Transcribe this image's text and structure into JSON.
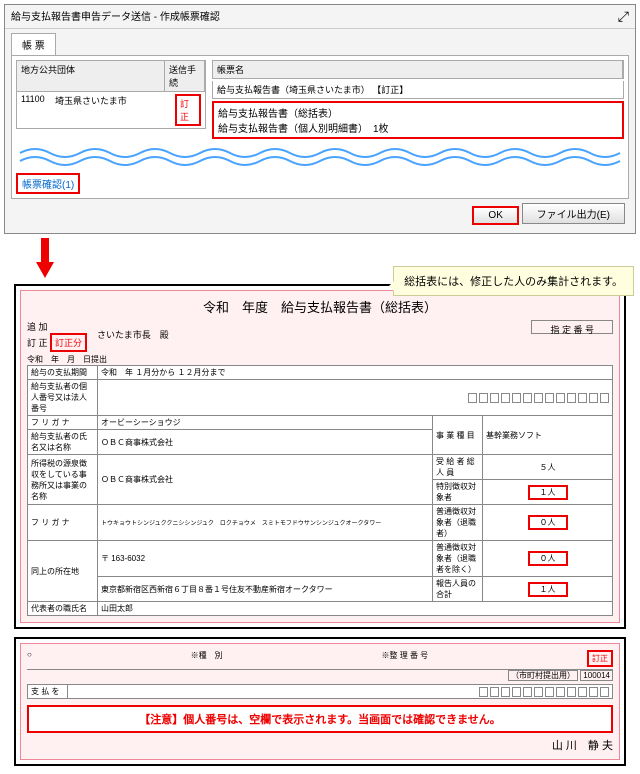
{
  "dialog": {
    "title": "給与支払報告書申告データ送信 - 作成帳票確認",
    "tab": "帳 票",
    "left_hdr1": "地方公共団体",
    "left_hdr2": "送信手続",
    "left_code": "11100",
    "left_name": "埼玉県さいたま市",
    "left_status": "訂正",
    "right_hdr": "帳票名",
    "right_line0": "給与支払報告書（埼玉県さいたま市） 【訂正】",
    "right_line1": "給与支払報告書（総括表）",
    "right_line2": "給与支払報告書（個人別明細書）　1枚",
    "confirm": "帳票確認(1)",
    "ok": "OK",
    "file_out": "ファイル出力(E)"
  },
  "form": {
    "title": "令和　年度　給与支払報告書（総括表）",
    "sub_add": "追 加",
    "sub_corr": "訂 正",
    "sub_corr_tag": "訂正分",
    "mayor": "さいたま市長　殿",
    "designation": "指 定 番 号",
    "submit": "令和　年　月　日提出",
    "period_lbl": "給与の支払期間",
    "period": "令和　年 １月分から １２月分まで",
    "corp_lbl": "給与支払者の個人番号又は法人番号",
    "furi_lbl": "フ リ ガ ナ",
    "furi1": "オービーシーショウジ",
    "name_lbl": "給与支払者の氏名又は名称",
    "name1": "ＯＢＣ商事株式会社",
    "loc_lbl": "所得税の源泉徴収をしている事務所又は事業の名称",
    "loc1": "ＯＢＣ商事株式会社",
    "furi2": "トウキョウトシンジュククニシシンジュク　ロクチョウメ　スミトモフドウサンシンジュクオークタワー",
    "zip": "〒 163-6032",
    "addr_lbl": "同上の所在地",
    "addr": "東京都新宿区西新宿６丁目８番１号住友不動産新宿オークタワー",
    "rep_lbl": "代表者の職氏名",
    "rep": "山田太郎",
    "biz_lbl": "事 業 種 目",
    "soft_lbl": "基幹業務ソフト",
    "emp_lbl": "受 給 者 総 人 員",
    "emp": "５人",
    "c1": "特別徴収対象者",
    "v1": "１人",
    "c2": "普通徴収対象者（退職者）",
    "v2": "０人",
    "c3": "普通徴収対象者（退職者を除く）",
    "v3": "０人",
    "c4": "報告人員の合計",
    "v4": "１人"
  },
  "callout": "総括表には、修正した人のみ集計されます。",
  "form2": {
    "city_lbl": "（市町村提出用）",
    "cat_lbl": "※種　別",
    "num_lbl": "※整 理 番 号",
    "corr": "訂正",
    "payer_num": "100014",
    "payer_lbl": "支 払 を",
    "name": "山 川　静 夫"
  },
  "caution": "【注意】個人番号は、空欄で表示されます。当画面では確認できません。"
}
